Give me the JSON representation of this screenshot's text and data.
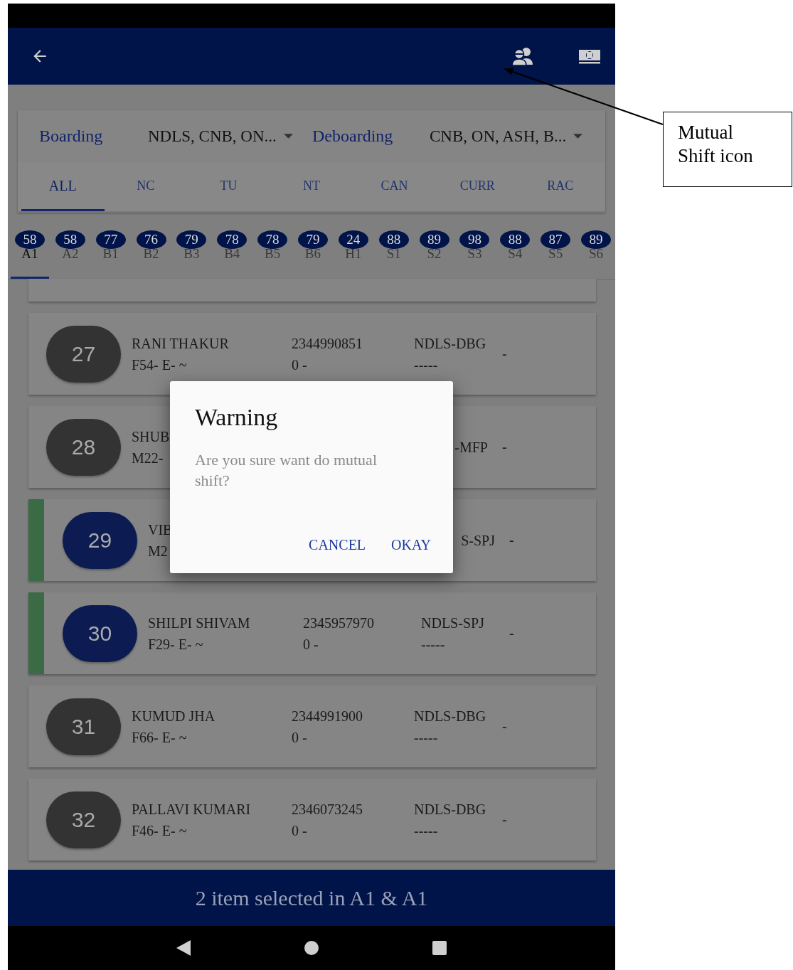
{
  "filters": {
    "boarding": {
      "label": "Boarding",
      "value": "NDLS, CNB, ON..."
    },
    "deboarding": {
      "label": "Deboarding",
      "value": "CNB, ON, ASH, B..."
    }
  },
  "tabs": [
    {
      "label": "ALL",
      "selected": true
    },
    {
      "label": "NC",
      "selected": false
    },
    {
      "label": "TU",
      "selected": false
    },
    {
      "label": "NT",
      "selected": false
    },
    {
      "label": "CAN",
      "selected": false
    },
    {
      "label": "CURR",
      "selected": false
    },
    {
      "label": "RAC",
      "selected": false
    }
  ],
  "coaches": [
    {
      "count": "58",
      "name": "A1",
      "selected": true
    },
    {
      "count": "58",
      "name": "A2",
      "selected": false
    },
    {
      "count": "77",
      "name": "B1",
      "selected": false
    },
    {
      "count": "76",
      "name": "B2",
      "selected": false
    },
    {
      "count": "79",
      "name": "B3",
      "selected": false
    },
    {
      "count": "78",
      "name": "B4",
      "selected": false
    },
    {
      "count": "78",
      "name": "B5",
      "selected": false
    },
    {
      "count": "79",
      "name": "B6",
      "selected": false
    },
    {
      "count": "24",
      "name": "H1",
      "selected": false
    },
    {
      "count": "88",
      "name": "S1",
      "selected": false
    },
    {
      "count": "89",
      "name": "S2",
      "selected": false
    },
    {
      "count": "98",
      "name": "S3",
      "selected": false
    },
    {
      "count": "88",
      "name": "S4",
      "selected": false
    },
    {
      "count": "87",
      "name": "S5",
      "selected": false
    },
    {
      "count": "89",
      "name": "S6",
      "selected": false
    }
  ],
  "passengers": [
    {
      "kind": "full",
      "berth": "27",
      "name": "RANI THAKUR",
      "seat": "F54- E- ~",
      "phone": "2344990851",
      "amount": "0 -",
      "route": "NDLS-DBG",
      "status": "-----",
      "mark": "-",
      "selected": false
    },
    {
      "kind": "covered",
      "berth": "28",
      "name": "SHUB",
      "seat": "M22-",
      "route": "-MFP",
      "mark": "-",
      "selected": false
    },
    {
      "kind": "covered",
      "berth": "29",
      "name": "VIB",
      "seat": "M2",
      "route": "S-SPJ",
      "mark": "-",
      "selected": true
    },
    {
      "kind": "full",
      "berth": "30",
      "name": "SHILPI SHIVAM",
      "seat": "F29- E- ~",
      "phone": "2345957970",
      "amount": "0 -",
      "route": "NDLS-SPJ",
      "status": "-----",
      "mark": "-",
      "selected": true
    },
    {
      "kind": "full",
      "berth": "31",
      "name": "KUMUD JHA",
      "seat": "F66- E- ~",
      "phone": "2344991900",
      "amount": "0 -",
      "route": "NDLS-DBG",
      "status": "-----",
      "mark": "-",
      "selected": false
    },
    {
      "kind": "full",
      "berth": "32",
      "name": "PALLAVI KUMARI",
      "seat": "F46- E- ~",
      "phone": "2346073245",
      "amount": "0 -",
      "route": "NDLS-DBG",
      "status": "-----",
      "mark": "-",
      "selected": false
    }
  ],
  "dialog": {
    "title": "Warning",
    "message": "Are you sure want do mutual shift?",
    "buttons": [
      "CANCEL",
      "OKAY"
    ]
  },
  "selection_bar": "2 item selected in A1 & A1",
  "annotation": "Mutual Shift icon"
}
